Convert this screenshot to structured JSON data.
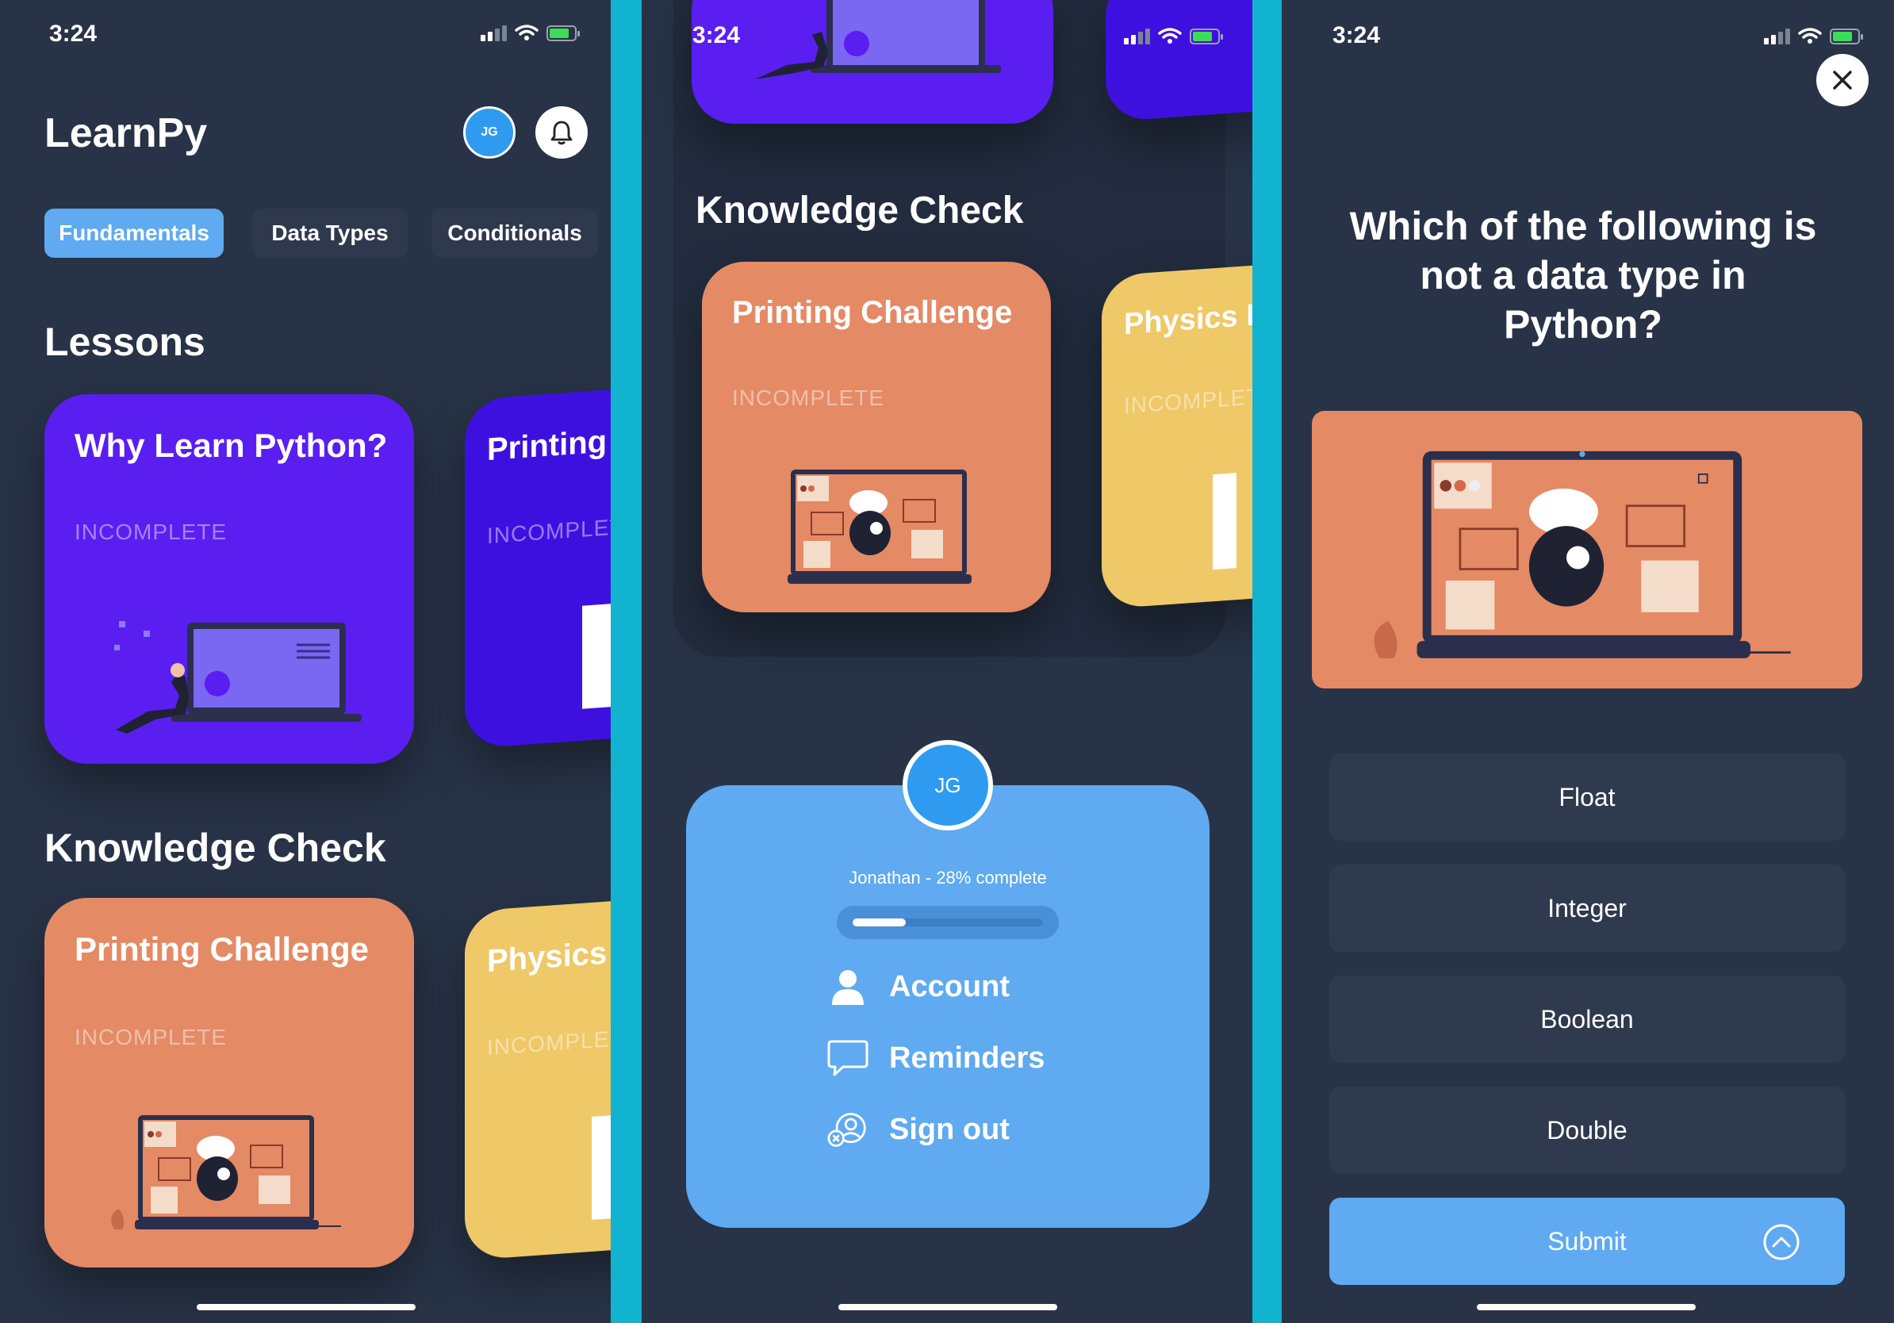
{
  "colors": {
    "panel_bg": "#283347",
    "divider": "#12B3D0",
    "accent_blue": "#5FAAF0",
    "purple": "#5A1EF0",
    "orange": "#E48A65",
    "yellow": "#EFC867"
  },
  "status_bar": {
    "time": "3:24"
  },
  "home": {
    "app_title": "LearnPy",
    "avatar_initials": "JG",
    "tabs": [
      {
        "label": "Fundamentals",
        "active": true
      },
      {
        "label": "Data Types",
        "active": false
      },
      {
        "label": "Conditionals",
        "active": false
      }
    ],
    "lessons_title": "Lessons",
    "lessons": [
      {
        "title": "Why Learn Python?",
        "status": "INCOMPLETE"
      },
      {
        "title": "Printing to Consol",
        "status": "INCOMPLET"
      }
    ],
    "knowledge_title": "Knowledge Check",
    "checks": [
      {
        "title": "Printing Challenge",
        "status": "INCOMPLETE"
      },
      {
        "title": "Physics Problem",
        "status": "INCOMPLET"
      }
    ]
  },
  "profile_panel": {
    "knowledge_title": "Knowledge Check",
    "checks": [
      {
        "title": "Printing Challenge",
        "status": "INCOMPLETE"
      },
      {
        "title": "Physics Problem",
        "status": "INCOMPLET"
      }
    ],
    "avatar_initials": "JG",
    "progress_text": "Jonathan - 28% complete",
    "progress_fraction": 0.28,
    "menu": [
      {
        "label": "Account",
        "icon": "person-icon"
      },
      {
        "label": "Reminders",
        "icon": "chat-bubble-icon"
      },
      {
        "label": "Sign out",
        "icon": "sign-out-icon"
      }
    ]
  },
  "quiz": {
    "question": "Which of the following is not a data type in Python?",
    "answers": [
      "Float",
      "Integer",
      "Boolean",
      "Double"
    ],
    "submit_label": "Submit"
  }
}
